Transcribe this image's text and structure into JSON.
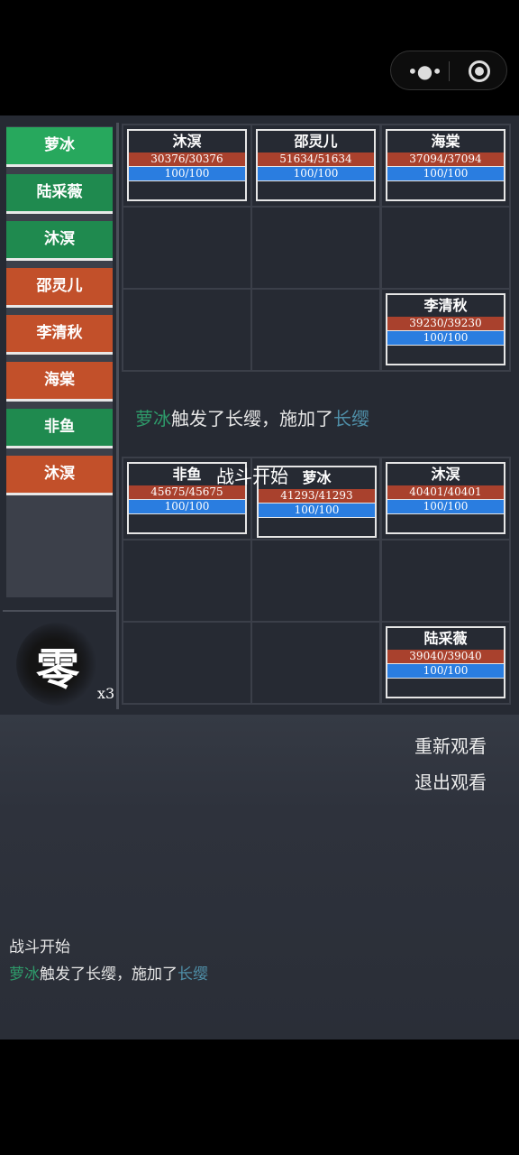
{
  "top_bar": {
    "menu_icon": "more-dots-icon",
    "record_icon": "record-icon"
  },
  "sidebar": {
    "items": [
      {
        "label": "萝冰",
        "team": "green"
      },
      {
        "label": "陆采薇",
        "team": "green"
      },
      {
        "label": "沐溟",
        "team": "green"
      },
      {
        "label": "邵灵儿",
        "team": "orange"
      },
      {
        "label": "李清秋",
        "team": "orange"
      },
      {
        "label": "海棠",
        "team": "orange"
      },
      {
        "label": "非鱼",
        "team": "green"
      },
      {
        "label": "沐溟",
        "team": "orange"
      }
    ],
    "emblem_char": "零",
    "multiplier": "x3"
  },
  "enemy_cards": [
    {
      "name": "沐溟",
      "hp": "30376/30376",
      "mp": "100/100"
    },
    {
      "name": "邵灵儿",
      "hp": "51634/51634",
      "mp": "100/100"
    },
    {
      "name": "海棠",
      "hp": "37094/37094",
      "mp": "100/100"
    },
    {
      "name": "李清秋",
      "hp": "39230/39230",
      "mp": "100/100"
    }
  ],
  "ally_cards": [
    {
      "name": "非鱼",
      "hp": "45675/45675",
      "mp": "100/100"
    },
    {
      "name": "萝冰",
      "hp": "41293/41293",
      "mp": "100/100"
    },
    {
      "name": "沐溟",
      "hp": "40401/40401",
      "mp": "100/100"
    },
    {
      "name": "陆采薇",
      "hp": "39040/39040",
      "mp": "100/100"
    }
  ],
  "battle_message": {
    "actor": "萝冰",
    "middle": "触发了长缨，施加了",
    "effect": "长缨"
  },
  "overlay_text": "战斗开始",
  "actions": {
    "replay": "重新观看",
    "exit": "退出观看"
  },
  "log": {
    "line1": "战斗开始",
    "line2_actor": "萝冰",
    "line2_middle": "触发了长缨，施加了",
    "line2_effect": "长缨"
  },
  "colors": {
    "green": "#1f8a4f",
    "orange": "#c2502a",
    "hp": "#a9412d",
    "mp": "#2a7de0"
  }
}
